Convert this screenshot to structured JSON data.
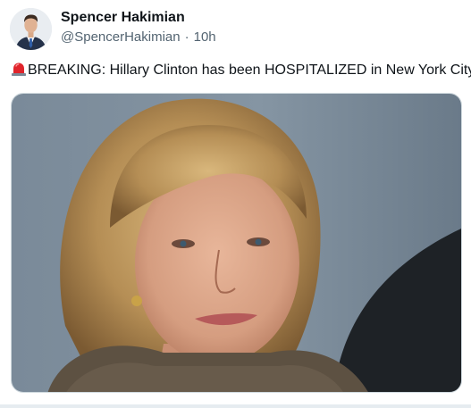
{
  "author": {
    "display_name": "Spencer Hakimian",
    "handle": "@SpencerHakimian",
    "separator": "·",
    "time": "10h",
    "avatar_icon": "profile-photo"
  },
  "tweet": {
    "emoji_icon": "police-siren-emoji",
    "text": "BREAKING: Hillary Clinton has been HOSPITALIZED in New York City."
  },
  "media": {
    "type": "photo",
    "description_icon": "portrait-photo"
  },
  "colors": {
    "text_primary": "#0f1419",
    "text_secondary": "#536471",
    "border": "#cfd9de",
    "siren_red": "#e0242b"
  }
}
